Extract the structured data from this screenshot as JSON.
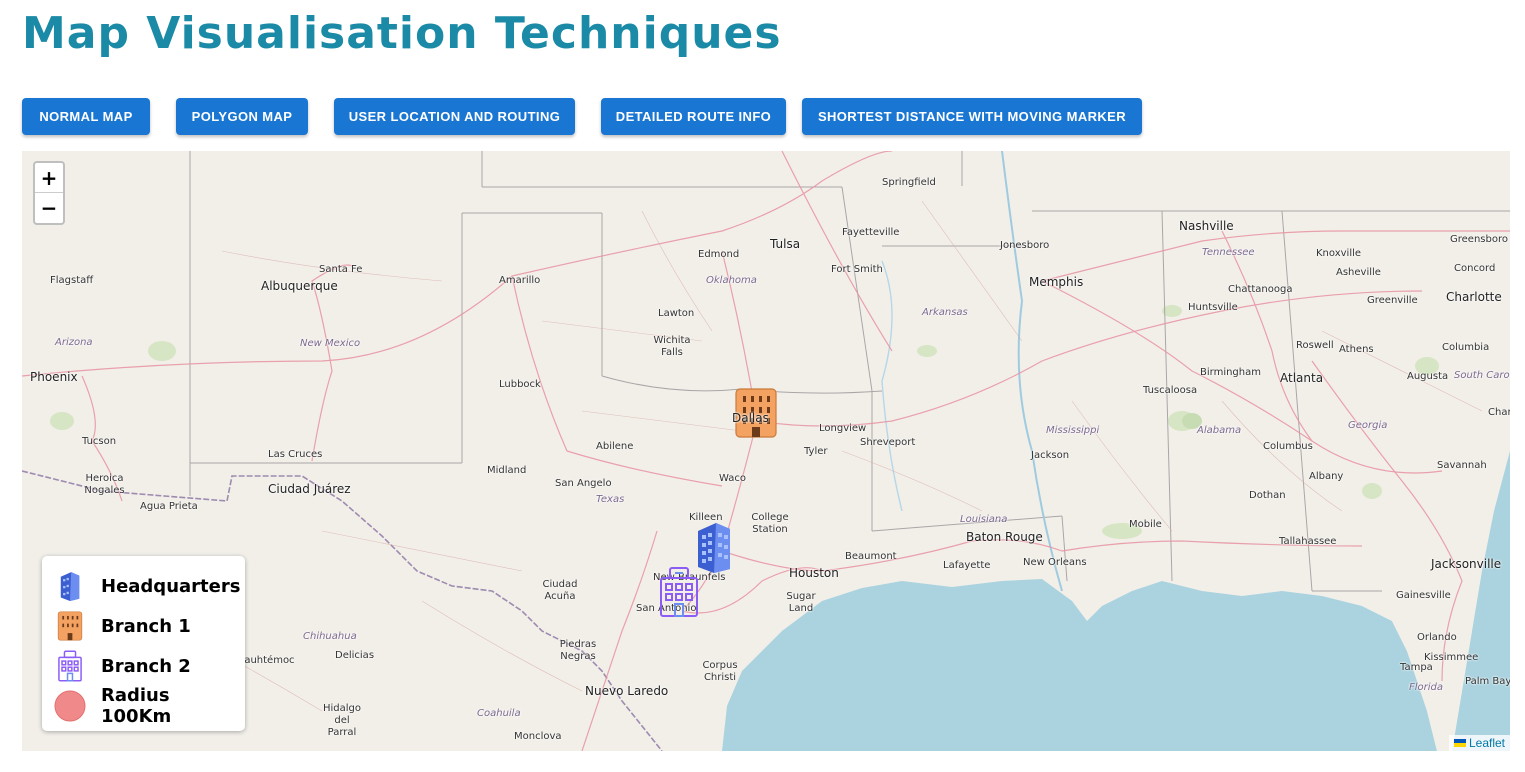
{
  "page": {
    "title": "Map Visualisation Techniques"
  },
  "toolbar": {
    "buttons": [
      {
        "label": "NORMAL MAP"
      },
      {
        "label": "POLYGON MAP"
      },
      {
        "label": "USER LOCATION AND ROUTING"
      },
      {
        "label": "DETAILED ROUTE INFO"
      },
      {
        "label": "SHORTEST DISTANCE WITH MOVING MARKER"
      }
    ]
  },
  "map": {
    "zoom_in": "+",
    "zoom_out": "−",
    "attribution": "Leaflet",
    "cities": [
      "Springfield",
      "Tulsa",
      "Fayetteville",
      "Jonesboro",
      "Nashville",
      "Greensboro",
      "Edmond",
      "Knoxville",
      "Santa Fe",
      "Amarillo",
      "Fort Smith",
      "Memphis",
      "Asheville",
      "Concord",
      "Flagstaff",
      "Albuquerque",
      "Chattanooga",
      "Charlotte",
      "Huntsville",
      "Greenville",
      "Lawton",
      "Wichita Falls",
      "Roswell",
      "Athens",
      "Columbia",
      "Phoenix",
      "Lubbock",
      "Birmingham",
      "Atlanta",
      "Augusta",
      "Tuscaloosa",
      "Longview",
      "Tucson",
      "Abilene",
      "Shreveport",
      "Columbus",
      "Las Cruces",
      "Midland",
      "Tyler",
      "Jackson",
      "Savannah",
      "Heroica Nogales",
      "Waco",
      "Ciudad Juárez",
      "San Angelo",
      "Albany",
      "Agua Prieta",
      "Dothan",
      "Killeen",
      "College Station",
      "Baton Rouge",
      "Mobile",
      "Beaumont",
      "Tallahassee",
      "Jacksonville",
      "Houston",
      "Lafayette",
      "New Orleans",
      "New Braunfels",
      "Ciudad Acuña",
      "San Antonio",
      "Sugar Land",
      "Gainesville",
      "Piedras Negras",
      "Delicias",
      "Cuauhtémoc",
      "Orlando",
      "Corpus Christi",
      "Kissimmee",
      "Nuevo Laredo",
      "Tampa",
      "Palm Bay",
      "Hidalgo del Parral",
      "Monclova",
      "Charleston",
      "Dallas"
    ],
    "regions": [
      "Tennessee",
      "Oklahoma",
      "Arkansas",
      "New Mexico",
      "Arizona",
      "South Carolina",
      "Alabama",
      "Georgia",
      "Mississippi",
      "Texas",
      "Louisiana",
      "Chihuahua",
      "Coahuila",
      "Florida"
    ],
    "markers": [
      {
        "name": "Headquarters",
        "icon": "blue-building-icon",
        "color": "#4a6fd8"
      },
      {
        "name": "Branch 1",
        "icon": "orange-building-icon",
        "color": "#f4a261"
      },
      {
        "name": "Branch 2",
        "icon": "purple-building-icon",
        "color": "#8b5cf6"
      }
    ]
  },
  "legend": {
    "items": [
      {
        "label": "Headquarters",
        "icon": "blue-building-icon"
      },
      {
        "label": "Branch 1",
        "icon": "orange-building-icon"
      },
      {
        "label": "Branch 2",
        "icon": "purple-building-icon"
      },
      {
        "label": "Radius 100Km",
        "icon": "red-circle-icon"
      }
    ]
  },
  "colors": {
    "accent": "#1976d2",
    "title": "#1a8aa6",
    "water": "#aad3df",
    "land": "#f2efe9"
  }
}
